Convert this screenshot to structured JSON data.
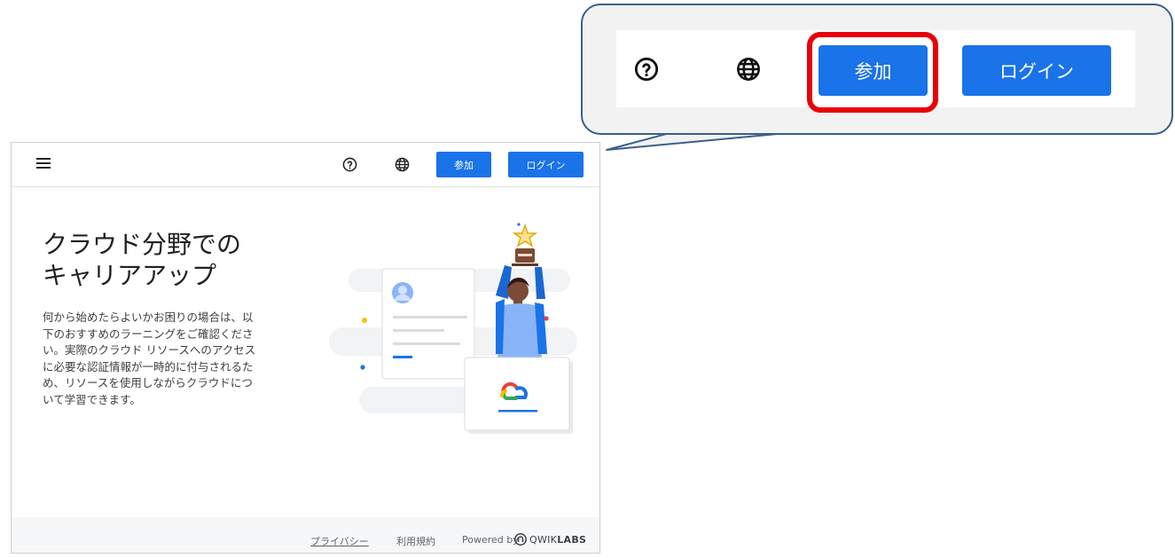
{
  "header": {
    "menu_icon": "hamburger-menu-icon",
    "help_icon": "help-circle-icon",
    "language_icon": "globe-icon",
    "join_label": "参加",
    "login_label": "ログイン"
  },
  "hero": {
    "title_lines": [
      "クラウド分野での",
      "キャリアアップ"
    ],
    "body_lines": [
      "何から始めたらよいかお困りの場合は、以",
      "下のおすすめのラーニングをご確認くださ",
      "い。実際のクラウド リソースへのアクセス",
      "に必要な認証情報が一時的に付与されるた",
      "め、リソースを使用しながらクラウドにつ",
      "いて学習できます。"
    ]
  },
  "footer": {
    "privacy": "プライバシー",
    "terms": "利用規約",
    "powered_by": "Powered by",
    "brand_light": "QWIK",
    "brand_bold": "LABS"
  },
  "callout": {
    "join_label": "参加",
    "login_label": "ログイン",
    "highlight_color": "#e8000b",
    "border_color": "#3b5f8e"
  },
  "colors": {
    "primary": "#1a73e8"
  }
}
